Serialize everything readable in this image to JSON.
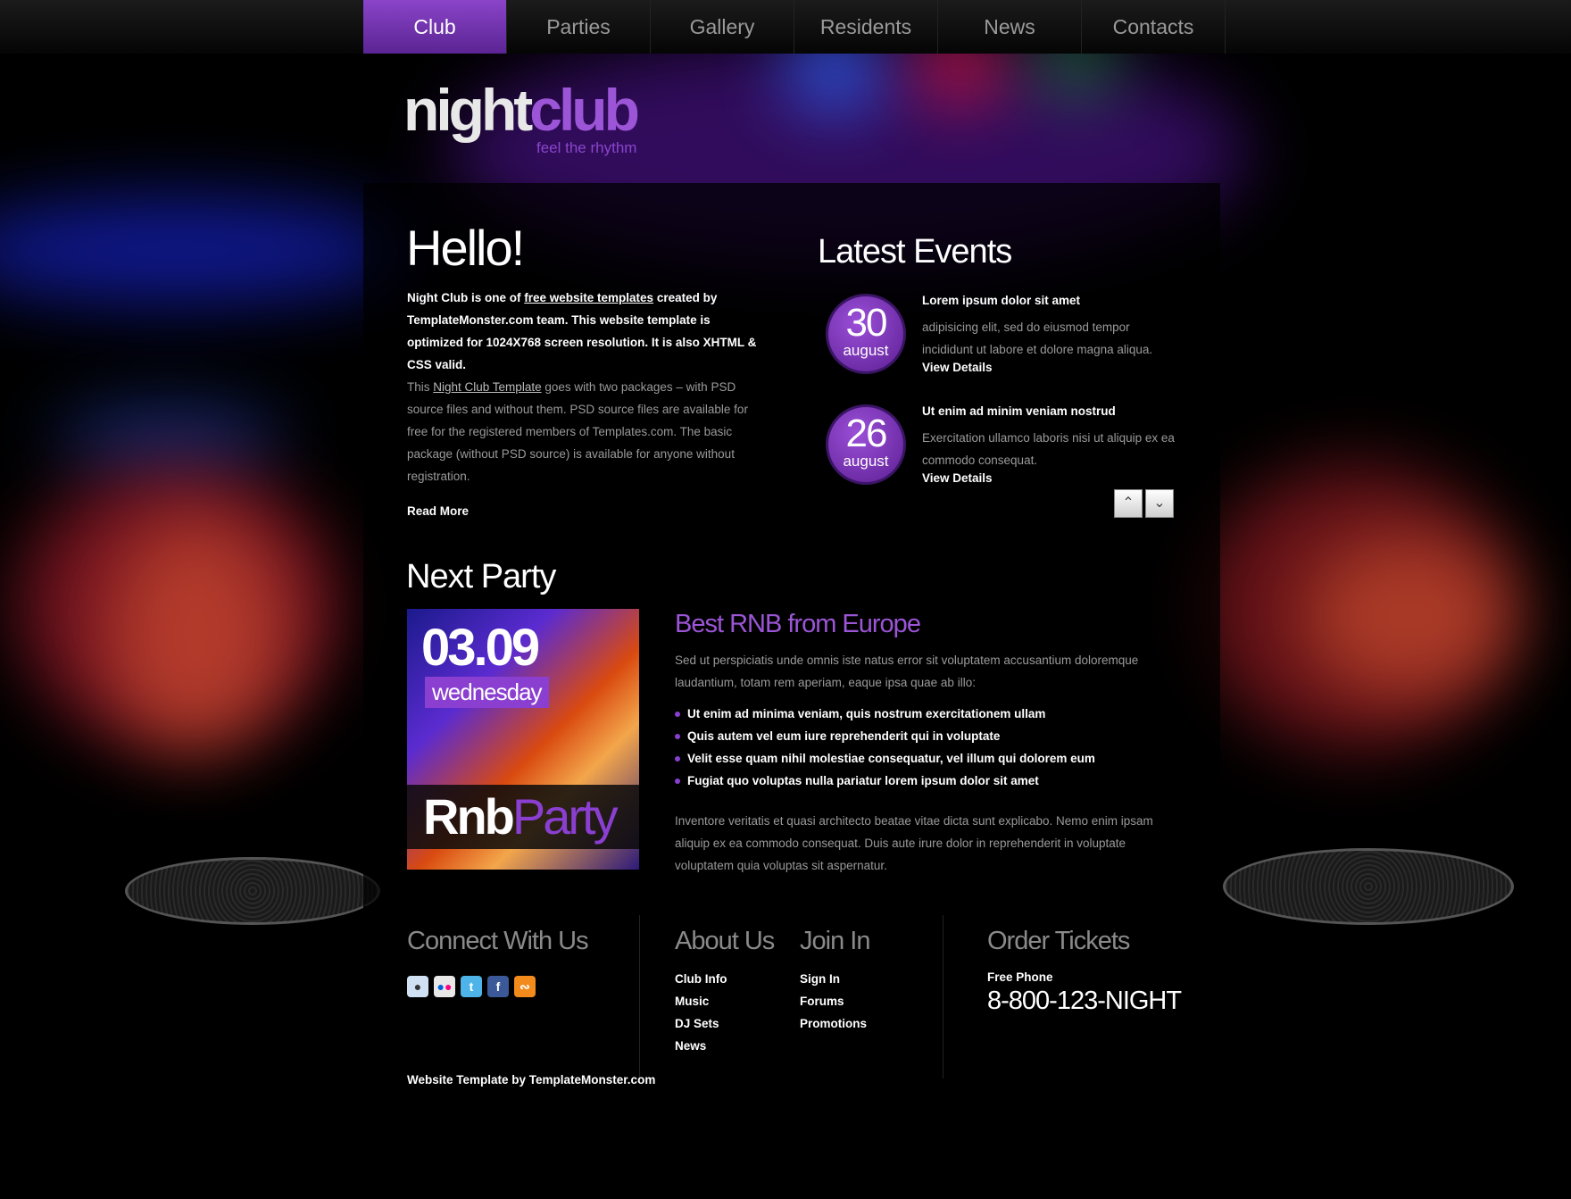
{
  "nav": {
    "items": [
      "Club",
      "Parties",
      "Gallery",
      "Residents",
      "News",
      "Contacts"
    ],
    "active": "Club"
  },
  "logo": {
    "night": "night",
    "club": "club",
    "tagline": "feel the rhythm"
  },
  "hello": {
    "title": "Hello!",
    "p1_pre": "Night Club is one of ",
    "p1_link": "free website templates",
    "p1_post": " created by TemplateMonster.com team. This website template is optimized for 1024X768 screen resolution. It is also XHTML & CSS valid.",
    "p2_pre": "This ",
    "p2_link": "Night Club Template",
    "p2_post": " goes with two packages – with PSD source files and without them. PSD source files are available for free for the registered members of Templates.com. The basic package (without PSD source) is available for anyone without registration.",
    "read_more": "Read More"
  },
  "events": {
    "title": "Latest Events",
    "items": [
      {
        "day": "30",
        "month": "august",
        "title": "Lorem ipsum dolor sit amet",
        "desc": "adipisicing elit, sed do eiusmod tempor incididunt ut labore et dolore magna aliqua.",
        "link": "View Details"
      },
      {
        "day": "26",
        "month": "august",
        "title": "Ut enim ad minim veniam nostrud",
        "desc": "Exercitation ullamco laboris nisi ut aliquip ex ea commodo consequat.",
        "link": "View Details"
      }
    ],
    "up_icon": "chevron-up-icon",
    "down_icon": "chevron-down-icon"
  },
  "party": {
    "title": "Next Party",
    "flyer_date": "03.09",
    "flyer_day": "wednesday",
    "flyer_rnb": "Rnb",
    "flyer_party": "Party",
    "headline": "Best RNB from Europe",
    "desc": "Sed ut perspiciatis unde omnis iste natus error sit voluptatem accusantium doloremque laudantium, totam rem aperiam, eaque ipsa quae ab illo:",
    "list": [
      "Ut enim ad minima veniam, quis nostrum exercitationem ullam",
      "Quis autem vel eum iure reprehenderit qui in voluptate",
      "Velit esse quam nihil molestiae consequatur, vel illum qui dolorem eum",
      "Fugiat quo voluptas nulla pariatur lorem ipsum dolor sit amet"
    ],
    "desc2": "Inventore veritatis et quasi architecto beatae vitae dicta sunt explicabo. Nemo enim ipsam aliquip ex ea commodo consequat. Duis aute irure dolor in reprehenderit in voluptate voluptatem quia voluptas sit aspernatur."
  },
  "footer": {
    "connect_title": "Connect With Us",
    "social": [
      "reddit-icon",
      "flickr-icon",
      "twitter-icon",
      "facebook-icon",
      "rss-icon"
    ],
    "about_title": "About Us",
    "about_links": [
      "Club Info",
      "Music",
      "DJ Sets",
      "News"
    ],
    "join_title": "Join In",
    "join_links": [
      "Sign In",
      "Forums",
      "Promotions"
    ],
    "tickets_title": "Order Tickets",
    "phone_label": "Free Phone",
    "phone": "8-800-123-NIGHT",
    "credit": "Website Template by TemplateMonster.com"
  },
  "colors": {
    "accent": "#8a3fd1",
    "background": "#000000"
  }
}
